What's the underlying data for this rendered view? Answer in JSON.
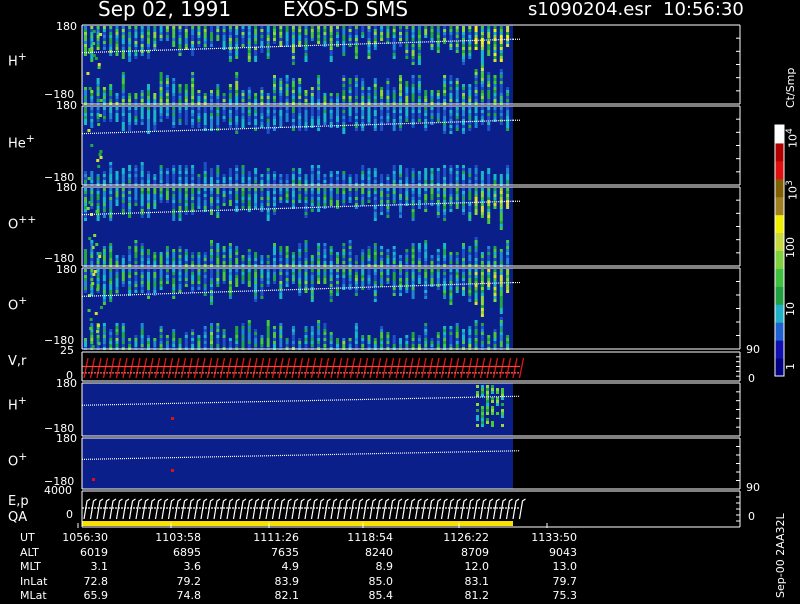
{
  "header": {
    "date": "Sep 02, 1991",
    "instrument": "EXOS-D SMS",
    "file": "s1090204.esr",
    "time": "10:56:30"
  },
  "panels": [
    {
      "label": "H",
      "sup": "+",
      "top_tick": "180",
      "bottom_tick": "−180"
    },
    {
      "label": "He",
      "sup": "+",
      "top_tick": "180",
      "bottom_tick": "−180"
    },
    {
      "label": "O",
      "sup": "++",
      "top_tick": "180",
      "bottom_tick": "−180"
    },
    {
      "label": "O",
      "sup": "+",
      "top_tick": "180",
      "bottom_tick": "−180"
    },
    {
      "label": "V,r",
      "sup": "",
      "top_tick": "25",
      "bottom_tick": "0",
      "right_top": "90",
      "right_bottom": "0"
    },
    {
      "label": "H",
      "sup": "+",
      "top_tick": "180",
      "bottom_tick": "−180"
    },
    {
      "label": "O",
      "sup": "+",
      "top_tick": "180",
      "bottom_tick": "−180"
    },
    {
      "label": "E,p",
      "label2": "QA",
      "sup": "",
      "top_tick": "4000",
      "bottom_tick": "0",
      "right_top": "90",
      "right_bottom": "0"
    }
  ],
  "colorbar": {
    "unit": "Ct/Smp",
    "labels": [
      "1",
      "10",
      "100",
      "10",
      "10"
    ],
    "exponents": [
      "",
      "",
      "",
      "3",
      "4"
    ],
    "colors": [
      "#000080",
      "#1010b0",
      "#2060d0",
      "#20b0c8",
      "#20a040",
      "#40c040",
      "#80d040",
      "#c8d840",
      "#f0f000",
      "#a08020",
      "#806000",
      "#e01010",
      "#b00000",
      "#ffffff"
    ]
  },
  "footer": {
    "rows": [
      {
        "label": "UT",
        "values": [
          "1056:30",
          "1103:58",
          "1111:26",
          "1118:54",
          "1126:22",
          "1133:50"
        ]
      },
      {
        "label": "ALT",
        "values": [
          "6019",
          "6895",
          "7635",
          "8240",
          "8709",
          "9043"
        ]
      },
      {
        "label": "MLT",
        "values": [
          "3.1",
          "3.6",
          "4.9",
          "8.9",
          "12.0",
          "13.0"
        ]
      },
      {
        "label": "InLat",
        "values": [
          "72.8",
          "79.2",
          "83.9",
          "85.0",
          "83.1",
          "79.7"
        ]
      },
      {
        "label": "MLat",
        "values": [
          "65.9",
          "74.8",
          "82.1",
          "85.4",
          "81.2",
          "75.3"
        ]
      }
    ],
    "version": "Sep-00 2AA32L"
  },
  "chart_data": {
    "type": "heatmap",
    "title": "Sep 02, 1991 EXOS-D SMS",
    "x": [
      "1056:30",
      "1103:58",
      "1111:26",
      "1118:54",
      "1126:22",
      "1133:50"
    ],
    "xlabel": "UT",
    "series": [
      {
        "name": "H+",
        "ylim": [
          -180,
          180
        ]
      },
      {
        "name": "He+",
        "ylim": [
          -180,
          180
        ]
      },
      {
        "name": "O++",
        "ylim": [
          -180,
          180
        ]
      },
      {
        "name": "O+",
        "ylim": [
          -180,
          180
        ]
      },
      {
        "name": "V,r",
        "ylim": [
          0,
          25
        ],
        "right_ylim": [
          0,
          90
        ]
      },
      {
        "name": "H+",
        "ylim": [
          -180,
          180
        ]
      },
      {
        "name": "O+",
        "ylim": [
          -180,
          180
        ]
      },
      {
        "name": "E,p QA",
        "ylim": [
          0,
          4000
        ],
        "right_ylim": [
          0,
          90
        ]
      }
    ],
    "colorbar": {
      "unit": "Ct/Smp",
      "scale": "log",
      "range": [
        1,
        10000
      ]
    }
  }
}
